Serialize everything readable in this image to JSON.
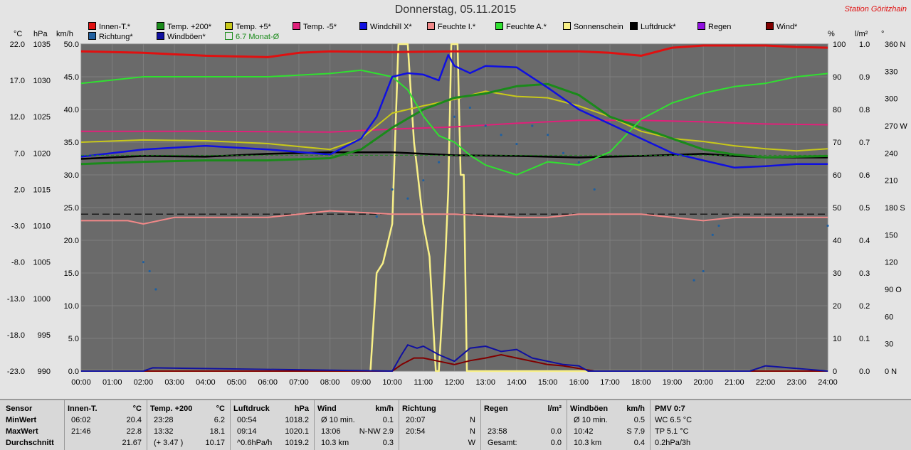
{
  "title": "Donnerstag, 05.11.2015",
  "station": "Station Göritzhain",
  "units_left": [
    "°C",
    "hPa",
    "km/h"
  ],
  "units_right": [
    "%",
    "l/m²",
    "°"
  ],
  "legend": [
    {
      "label": "Innen-T.*",
      "color": "#e01010"
    },
    {
      "label": "Temp. +200*",
      "color": "#1a8a1a"
    },
    {
      "label": "Temp. +5*",
      "color": "#c8c81a"
    },
    {
      "label": "Temp. -5*",
      "color": "#e0207a"
    },
    {
      "label": "Windchill X*",
      "color": "#1010e0"
    },
    {
      "label": "Feuchte I.*",
      "color": "#f08888"
    },
    {
      "label": "Feuchte A.*",
      "color": "#30e030"
    },
    {
      "label": "Sonnenschein",
      "color": "#f8f088"
    },
    {
      "label": "Luftdruck*",
      "color": "#000000"
    },
    {
      "label": "Regen",
      "color": "#9010e0"
    },
    {
      "label": "Wind*",
      "color": "#800000"
    },
    {
      "label": "Richtung*",
      "color": "#2060a0"
    },
    {
      "label": "Windböen*",
      "color": "#1010a0"
    },
    {
      "label": "6.7 Monat-Ø",
      "color": "#1a8a1a"
    }
  ],
  "chart_data": {
    "type": "line",
    "x_ticks": [
      "00:00",
      "01:00",
      "02:00",
      "03:00",
      "04:00",
      "05:00",
      "06:00",
      "07:00",
      "08:00",
      "09:00",
      "10:00",
      "11:00",
      "12:00",
      "13:00",
      "14:00",
      "15:00",
      "16:00",
      "17:00",
      "18:00",
      "19:00",
      "20:00",
      "21:00",
      "22:00",
      "23:00",
      "24:00"
    ],
    "axes": {
      "temperature_c": {
        "ticks": [
          "22.0",
          "17.0",
          "12.0",
          "7.0",
          "2.0",
          "-3.0",
          "-8.0",
          "-13.0",
          "-18.0",
          "-23.0"
        ],
        "range": [
          -23,
          22
        ]
      },
      "pressure_hpa": {
        "ticks": [
          "1035",
          "1030",
          "1025",
          "1020",
          "1015",
          "1010",
          "1005",
          "1000",
          "995",
          "990"
        ],
        "range": [
          990,
          1035
        ]
      },
      "wind_kmh": {
        "ticks": [
          "50.0",
          "45.0",
          "40.0",
          "35.0",
          "30.0",
          "25.0",
          "20.0",
          "15.0",
          "10.0",
          "5.0",
          "0.0"
        ],
        "range": [
          0,
          50
        ]
      },
      "humidity_pct": {
        "ticks": [
          "100",
          "90",
          "80",
          "70",
          "60",
          "50",
          "40",
          "30",
          "20",
          "10",
          "0"
        ],
        "range": [
          0,
          100
        ]
      },
      "rain_lm2": {
        "ticks": [
          "1.0",
          "0.9",
          "0.8",
          "0.7",
          "0.6",
          "0.5",
          "0.4",
          "0.3",
          "0.2",
          "0.1",
          "0.0"
        ],
        "range": [
          0,
          1
        ]
      },
      "direction_deg": {
        "ticks": [
          "360 N",
          "330",
          "300",
          "270 W",
          "240",
          "210",
          "180 S",
          "150",
          "120",
          "90 O",
          "60",
          "30",
          "0 N"
        ],
        "range": [
          0,
          360
        ]
      }
    },
    "series": [
      {
        "name": "Innen-T.*",
        "axis": "temperature_c",
        "x": [
          0,
          2,
          4,
          6,
          7,
          8,
          10,
          12,
          14,
          16,
          17,
          18,
          19,
          20,
          21,
          22,
          23,
          24
        ],
        "y": [
          21.0,
          20.8,
          20.4,
          20.2,
          20.8,
          21.0,
          20.9,
          21.0,
          21.0,
          21.0,
          20.8,
          20.4,
          21.5,
          21.8,
          21.8,
          21.8,
          21.6,
          21.5
        ]
      },
      {
        "name": "Temp. +200*",
        "axis": "temperature_c",
        "x": [
          0,
          2,
          4,
          6,
          8,
          9,
          10,
          11,
          12,
          13,
          14,
          15,
          16,
          17,
          18,
          19,
          20,
          21,
          22,
          23,
          24
        ],
        "y": [
          5.5,
          5.8,
          6.0,
          6.0,
          6.3,
          7.5,
          10.5,
          13.0,
          14.6,
          15.2,
          16.2,
          16.5,
          15.0,
          12.0,
          10.5,
          9.0,
          7.5,
          6.8,
          6.4,
          6.5,
          6.6
        ]
      },
      {
        "name": "Temp. +5*",
        "axis": "temperature_c",
        "x": [
          0,
          2,
          4,
          6,
          8,
          9,
          10,
          11,
          12,
          13,
          14,
          15,
          16,
          17,
          18,
          19,
          20,
          21,
          22,
          23,
          24
        ],
        "y": [
          8.5,
          8.8,
          8.7,
          8.3,
          7.5,
          9.0,
          12.5,
          13.5,
          14.4,
          15.5,
          14.8,
          14.6,
          13.5,
          12.0,
          10.0,
          9.0,
          8.6,
          8.0,
          7.6,
          7.3,
          7.6
        ]
      },
      {
        "name": "Temp. -5*",
        "axis": "temperature_c",
        "x": [
          0,
          4,
          8,
          10,
          12,
          14,
          16,
          18,
          20,
          22,
          24
        ],
        "y": [
          10.0,
          10.0,
          9.9,
          10.3,
          10.6,
          11.1,
          11.5,
          11.5,
          11.3,
          11.0,
          10.9
        ]
      },
      {
        "name": "Windchill X*",
        "axis": "temperature_c",
        "x": [
          0,
          2,
          4,
          6,
          8,
          9,
          9.5,
          10,
          10.5,
          11,
          11.5,
          11.8,
          12,
          12.5,
          13,
          14,
          15,
          16,
          17,
          18,
          19,
          20,
          21,
          22,
          23,
          24
        ],
        "y": [
          6.5,
          7.5,
          8.0,
          7.5,
          6.8,
          9.0,
          12.0,
          17.5,
          18.0,
          17.8,
          17.0,
          20.5,
          19.0,
          18.0,
          19.0,
          18.8,
          16.0,
          13.0,
          11.0,
          9.0,
          7.0,
          6.0,
          5.0,
          5.2,
          5.5,
          5.5
        ]
      },
      {
        "name": "Feuchte I.*",
        "axis": "humidity_pct",
        "x": [
          0,
          1.5,
          2,
          3,
          4,
          6,
          7,
          8,
          10,
          12,
          14,
          15,
          16,
          18,
          19,
          20,
          21,
          24
        ],
        "y": [
          46.0,
          46.0,
          45.0,
          47.0,
          47.0,
          47.0,
          48.0,
          49.0,
          48.0,
          48.0,
          47.0,
          47.0,
          48.0,
          48.0,
          47.0,
          46.0,
          47.0,
          47.0
        ]
      },
      {
        "name": "Feuchte A.*",
        "axis": "humidity_pct",
        "x": [
          0,
          1,
          2,
          4,
          6,
          8,
          9,
          10,
          10.5,
          11,
          11.5,
          12,
          12.5,
          13,
          14,
          15,
          16,
          17,
          18,
          19,
          20,
          21,
          22,
          23,
          24
        ],
        "y": [
          88.0,
          89.0,
          90.0,
          90.0,
          90.0,
          91.0,
          92.0,
          90.0,
          86.0,
          78.0,
          72.0,
          70.0,
          66.0,
          63.0,
          60.0,
          64.0,
          63.0,
          67.0,
          77.0,
          82.0,
          85.0,
          87.0,
          88.0,
          90.0,
          91.0
        ]
      },
      {
        "name": "Luftdruck*",
        "axis": "pressure_hpa",
        "x": [
          0,
          2,
          4,
          6,
          8,
          10,
          12,
          14,
          16,
          18,
          20,
          21,
          22,
          23,
          24
        ],
        "y": [
          1019.2,
          1019.6,
          1019.5,
          1019.9,
          1020.1,
          1020.1,
          1019.7,
          1019.6,
          1019.4,
          1019.6,
          1019.9,
          1019.6,
          1019.4,
          1019.4,
          1019.4
        ]
      },
      {
        "name": "Sonnenschein",
        "axis": "humidity_pct",
        "x": [
          0,
          9.3,
          9.5,
          9.7,
          10,
          10.2,
          10.3,
          10.5,
          10.7,
          10.8,
          11,
          11.2,
          11.4,
          11.5,
          11.7,
          11.8,
          11.9,
          12.1,
          12.2,
          12.3,
          12.4,
          24
        ],
        "y": [
          0,
          0,
          30,
          33,
          45,
          100,
          100,
          100,
          70,
          62,
          45,
          35,
          0,
          0,
          33,
          55,
          100,
          100,
          60,
          60,
          0,
          0
        ]
      },
      {
        "name": "6.7 Monat-Ø",
        "axis": "temperature_c",
        "x": [
          0,
          24
        ],
        "y": [
          6.7,
          6.7
        ]
      },
      {
        "name": "Richtung*",
        "axis": "direction_deg",
        "x": [
          2.0,
          2.2,
          2.4,
          9.5,
          10,
          10.5,
          11,
          11.5,
          12,
          12.5,
          13,
          13.5,
          14,
          14.5,
          15,
          15.5,
          16,
          16.5,
          19.7,
          20,
          20.3,
          20.5,
          24
        ],
        "y": [
          120,
          110,
          90,
          170,
          200,
          190,
          210,
          230,
          280,
          290,
          270,
          260,
          250,
          270,
          260,
          240,
          230,
          200,
          100,
          110,
          150,
          160,
          160
        ]
      },
      {
        "name": "Wind*",
        "axis": "wind_kmh",
        "x": [
          0,
          10,
          10.3,
          10.7,
          11,
          11.5,
          12,
          12.5,
          13,
          13.5,
          14,
          14.5,
          15,
          15.5,
          16,
          16.5,
          24
        ],
        "y": [
          0,
          0,
          1.0,
          2.0,
          2.0,
          1.5,
          1.0,
          1.6,
          2.0,
          2.5,
          2.0,
          1.5,
          1.0,
          0.8,
          0.4,
          0,
          0
        ]
      },
      {
        "name": "Windböen*",
        "axis": "wind_kmh",
        "x": [
          0,
          2,
          2.3,
          10,
          10.3,
          10.5,
          10.8,
          11,
          11.5,
          12,
          12.5,
          13,
          13.5,
          14,
          14.5,
          15,
          15.5,
          16,
          16.3,
          21.5,
          22,
          24
        ],
        "y": [
          0,
          0,
          0.5,
          0,
          2.5,
          4.0,
          3.5,
          3.8,
          2.5,
          1.5,
          3.5,
          3.8,
          3.0,
          3.3,
          2.0,
          1.5,
          1.0,
          0.8,
          0,
          0,
          0.8,
          0
        ]
      }
    ],
    "reference_line_pct": 48
  },
  "table": {
    "sensor": {
      "header": "Sensor",
      "rows": [
        "MinWert",
        "MaxWert",
        "Durchschnitt"
      ]
    },
    "innen": {
      "header": "Innen-T.",
      "unit": "°C",
      "rows": [
        [
          "06:02",
          "20.4"
        ],
        [
          "21:46",
          "22.8"
        ],
        [
          "",
          "21.67"
        ]
      ]
    },
    "temp200": {
      "header": "Temp. +200",
      "unit": "°C",
      "rows": [
        [
          "23:28",
          "6.2"
        ],
        [
          "13:32",
          "18.1"
        ],
        [
          "(+ 3.47 )",
          "10.17"
        ]
      ]
    },
    "luftdruck": {
      "header": "Luftdruck",
      "unit": "hPa",
      "rows": [
        [
          "00:54",
          "1018.2"
        ],
        [
          "09:14",
          "1020.1"
        ],
        [
          "^0.6hPa/h",
          "1019.2"
        ]
      ]
    },
    "wind": {
      "header": "Wind",
      "unit": "km/h",
      "rows": [
        [
          "Ø 10 min.",
          "0.1"
        ],
        [
          "13:06",
          "N-NW 2.9"
        ],
        [
          "10.3 km",
          "0.3"
        ]
      ]
    },
    "richtung": {
      "header": "Richtung",
      "rows": [
        [
          "20:07",
          "N"
        ],
        [
          "20:54",
          "N"
        ],
        [
          "",
          "W"
        ]
      ]
    },
    "regen": {
      "header": "Regen",
      "unit": "l/m²",
      "rows": [
        [
          "",
          ""
        ],
        [
          "23:58",
          "0.0"
        ],
        [
          "Gesamt:",
          "0.0"
        ]
      ]
    },
    "windboeen": {
      "header": "Windböen",
      "unit": "km/h",
      "rows": [
        [
          "Ø 10 min.",
          "0.5"
        ],
        [
          "10:42",
          "S 7.9"
        ],
        [
          "10.3 km",
          "0.4"
        ]
      ]
    },
    "pmv": {
      "header": "PMV 0:7",
      "rows": [
        "WC 6.5 °C",
        "TP 5.1 °C",
        "0.2hPa/3h"
      ]
    }
  }
}
